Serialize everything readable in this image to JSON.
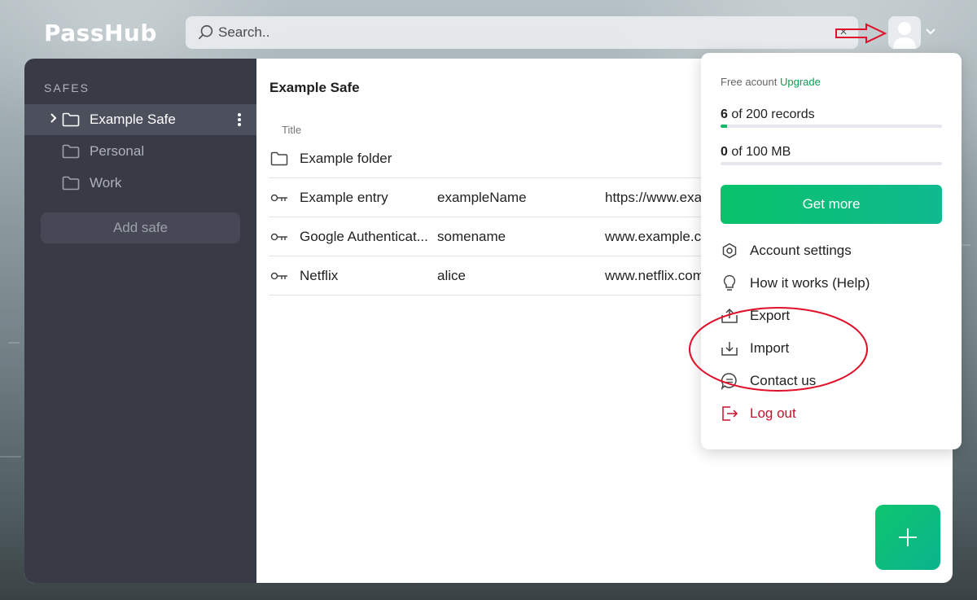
{
  "app": {
    "logo": "PassHub"
  },
  "search": {
    "placeholder": "Search..",
    "clear_glyph": "×"
  },
  "sidebar": {
    "title": "SAFES",
    "safes": [
      {
        "label": "Example Safe",
        "active": true
      },
      {
        "label": "Personal",
        "active": false
      },
      {
        "label": "Work",
        "active": false
      }
    ],
    "add_safe_label": "Add safe"
  },
  "main": {
    "safe_name": "Example Safe",
    "column_title": "Title",
    "rows": [
      {
        "type": "folder",
        "title": "Example folder",
        "username": "",
        "url": ""
      },
      {
        "type": "entry",
        "title": "Example entry",
        "username": "exampleName",
        "url": "https://www.exa"
      },
      {
        "type": "entry",
        "title": "Google Authenticat...",
        "username": "somename",
        "url": "www.example.c"
      },
      {
        "type": "entry",
        "title": "Netflix",
        "username": "alice",
        "url": "www.netflix.com"
      }
    ]
  },
  "account_menu": {
    "plan_text": "Free acount",
    "upgrade_label": "Upgrade",
    "records": {
      "used": "6",
      "rest": "of 200 records",
      "fraction": 0.03
    },
    "storage": {
      "used": "0",
      "rest": "of 100 MB",
      "fraction": 0.0
    },
    "get_more_label": "Get more",
    "items": [
      {
        "label": "Account settings",
        "icon": "hexagon-settings-icon"
      },
      {
        "label": "How it works (Help)",
        "icon": "lightbulb-icon"
      },
      {
        "label": "Export",
        "icon": "export-icon"
      },
      {
        "label": "Import",
        "icon": "import-icon"
      },
      {
        "label": "Contact us",
        "icon": "chat-icon"
      },
      {
        "label": "Log out",
        "icon": "logout-icon"
      }
    ]
  },
  "fab": {
    "glyph": "+"
  },
  "colors": {
    "accent_green": "#0ec66e",
    "sidebar_bg": "#383a46",
    "logout_red": "#c8102e",
    "annotation_red": "#e0102a"
  }
}
